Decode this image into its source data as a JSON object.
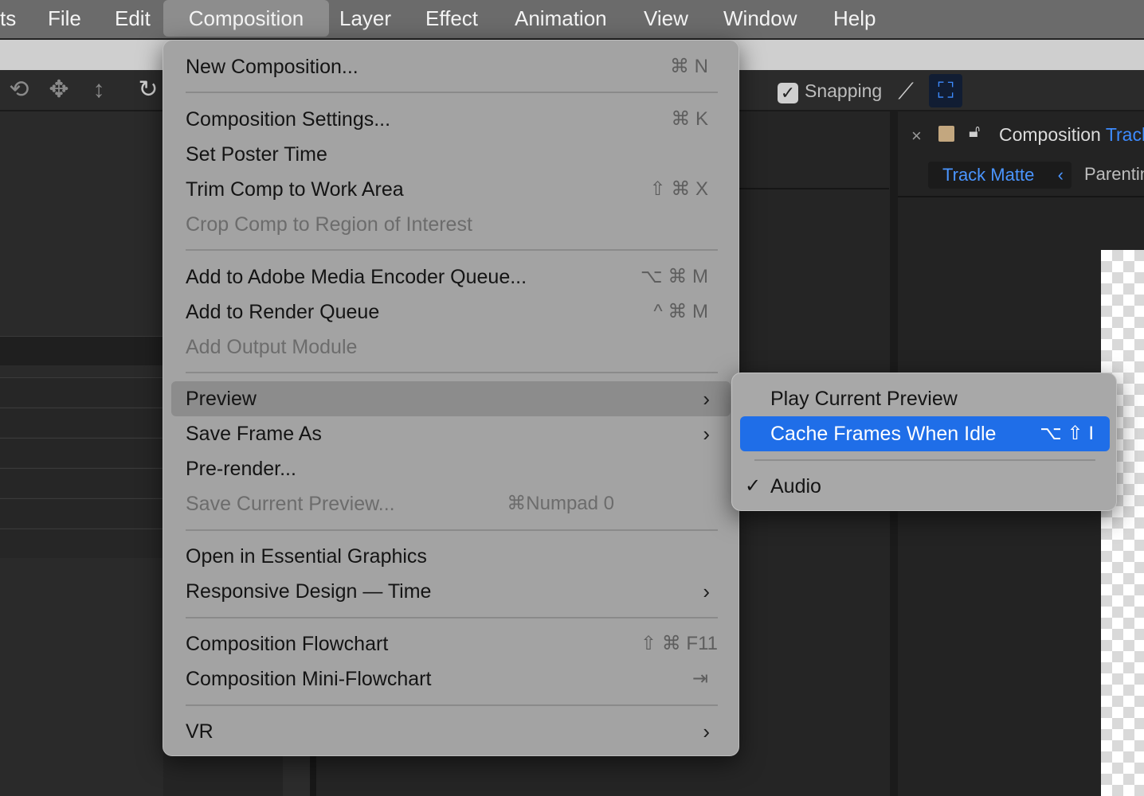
{
  "menubar": {
    "items": [
      "ts",
      "File",
      "Edit",
      "Composition",
      "Layer",
      "Effect",
      "Animation",
      "View",
      "Window",
      "Help"
    ]
  },
  "toolbar": {
    "snapping_label": "Snapping",
    "snapping_checked": true
  },
  "comp_menu": {
    "items": [
      {
        "label": "New Composition...",
        "shortcut": "⌘ N"
      },
      {
        "label": "Composition Settings...",
        "shortcut": "⌘ K"
      },
      {
        "label": "Set Poster Time",
        "shortcut": ""
      },
      {
        "label": "Trim Comp to Work Area",
        "shortcut": "⇧ ⌘ X"
      },
      {
        "label": "Crop Comp to Region of Interest",
        "shortcut": "",
        "disabled": true
      },
      {
        "label": "Add to Adobe Media Encoder Queue...",
        "shortcut": "⌥ ⌘ M"
      },
      {
        "label": "Add to Render Queue",
        "shortcut": "^ ⌘ M"
      },
      {
        "label": "Add Output Module",
        "shortcut": "",
        "disabled": true
      },
      {
        "label": "Preview",
        "submenu": true,
        "highlighted": true
      },
      {
        "label": "Save Frame As",
        "submenu": true
      },
      {
        "label": "Pre-render...",
        "shortcut": ""
      },
      {
        "label": "Save Current Preview...",
        "shortcut": "⌘Numpad 0",
        "disabled": true
      },
      {
        "label": "Open in Essential Graphics",
        "shortcut": ""
      },
      {
        "label": "Responsive Design — Time",
        "submenu": true
      },
      {
        "label": "Composition Flowchart",
        "shortcut": "⇧ ⌘ F11"
      },
      {
        "label": "Composition Mini-Flowchart",
        "shortcut": "⇥"
      },
      {
        "label": "VR",
        "submenu": true
      }
    ]
  },
  "preview_submenu": {
    "items": [
      {
        "label": "Play Current Preview",
        "shortcut": ""
      },
      {
        "label": "Cache Frames When Idle",
        "shortcut": "⌥ ⇧ I",
        "selected": true
      },
      {
        "label": "Audio",
        "checked": true
      }
    ]
  },
  "right_panel": {
    "tab_prefix": "Composition",
    "tab_name": "Track",
    "track_matte_label": "Track Matte",
    "parenting_label": "Parentin"
  },
  "icons": {
    "submenu_arrow": "›",
    "check": "✓",
    "close": "×"
  },
  "colors": {
    "menubar": "#6b6b6b",
    "menu_bg": "#a3a3a3",
    "selection_blue": "#1f6ee8",
    "accent_blue": "#3d8bff",
    "swatch": "#c3a77f"
  }
}
